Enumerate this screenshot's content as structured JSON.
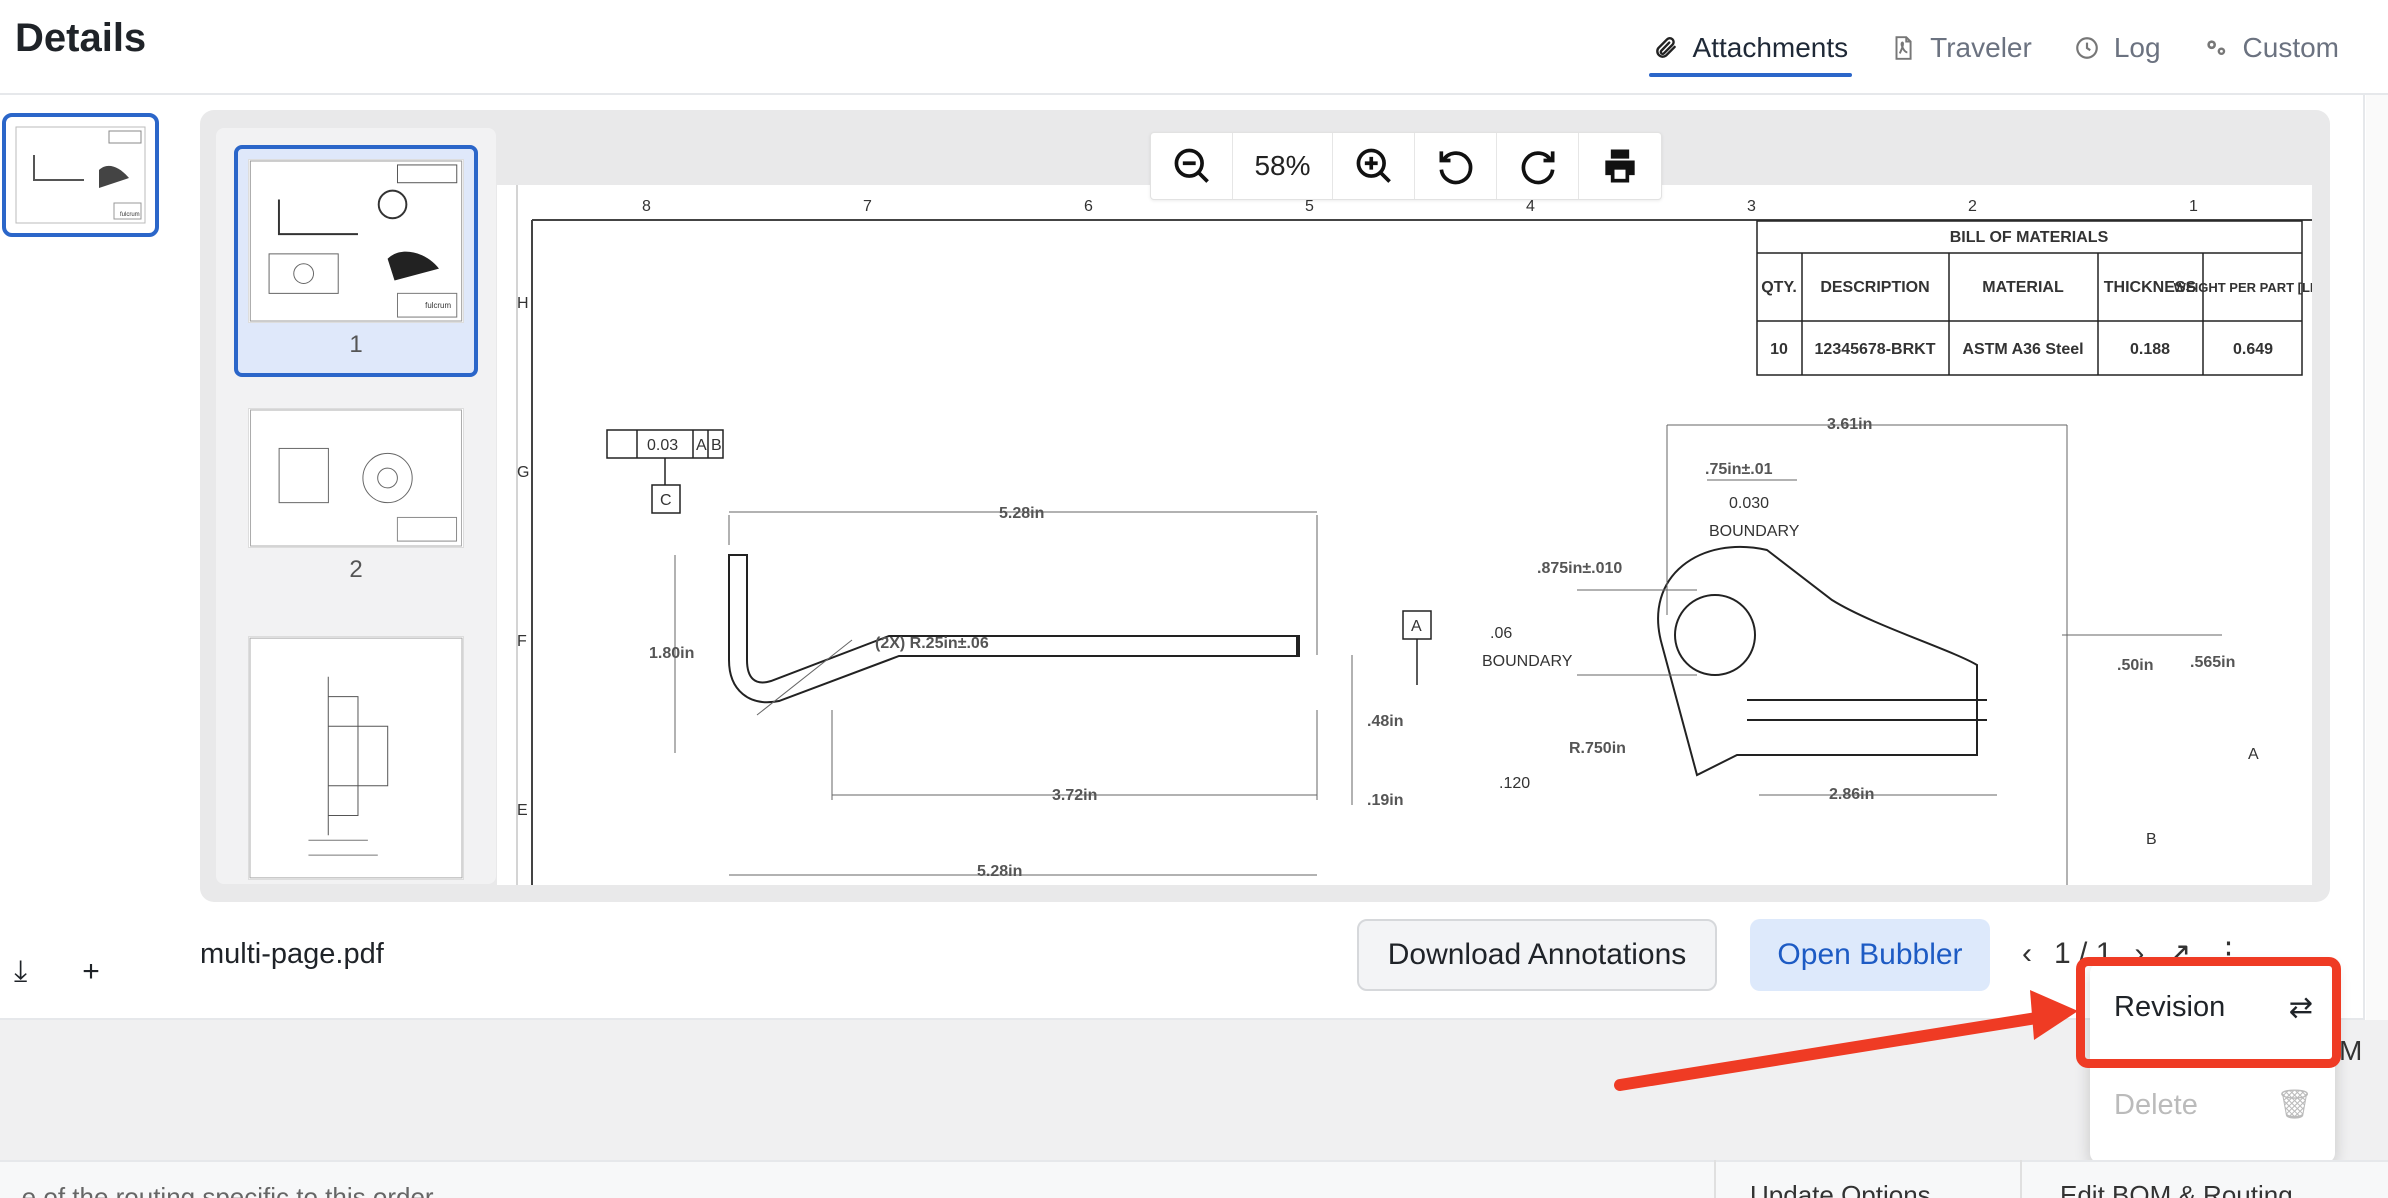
{
  "header": {
    "title": "Details",
    "tabs": [
      {
        "label": "Attachments",
        "icon": "paperclip-icon",
        "active": true
      },
      {
        "label": "Traveler",
        "icon": "pdf-file-icon",
        "active": false
      },
      {
        "label": "Log",
        "icon": "clock-icon",
        "active": false
      },
      {
        "label": "Custom",
        "icon": "gears-icon",
        "active": false
      }
    ]
  },
  "viewer": {
    "zoom": "58%",
    "pages": [
      "1",
      "2"
    ],
    "filename": "multi-page.pdf",
    "pager": "1 / 1"
  },
  "drawing": {
    "bom_title": "BILL OF MATERIALS",
    "bom_headers": [
      "QTY.",
      "DESCRIPTION",
      "MATERIAL",
      "THICKNESS",
      "WEIGHT PER PART [LBS]"
    ],
    "bom_row": [
      "10",
      "12345678-BRKT",
      "ASTM A36 Steel",
      "0.188",
      "0.649"
    ],
    "col_labels": [
      "8",
      "7",
      "6",
      "5",
      "4",
      "3",
      "2",
      "1"
    ],
    "row_labels": [
      "H",
      "G",
      "F",
      "E"
    ],
    "dims": {
      "d1": "5.28in",
      "d2": "1.80in",
      "d3": "(2X) R.25in±.06",
      "d4": "3.72in",
      "d5": ".48in",
      "d6": ".19in",
      "d7": "5.28in",
      "d8": "3.61in",
      "d9": ".75in±.01",
      "d10": ".875in±.010",
      "d11": "R.750in",
      "d12": "2.86in",
      "d13": ".50in",
      "d14": ".565in",
      "fcf1": "0.03",
      "fcf1b": "A",
      "fcf1c": "B",
      "datum_c": "C",
      "datum_a": "A",
      "datum_b": "B",
      "fcf2": "0.030",
      "fcf3": ".06",
      "fcf4": ".120",
      "boundary": "BOUNDARY",
      "letter_a": "A",
      "letter_b": "B",
      "letter_c": "C",
      "letter_m": "M"
    }
  },
  "buttons": {
    "download_annotations": "Download Annotations",
    "open_bubbler": "Open Bubbler"
  },
  "menu": {
    "revision": "Revision",
    "delete": "Delete"
  },
  "bottom": {
    "note": "...e of the routing specific to this order",
    "btn1": "Update Options",
    "btn2": "Edit BOM & Routing",
    "m": "M"
  },
  "colors": {
    "accent": "#2b66c9",
    "highlight": "#ef3b24"
  }
}
